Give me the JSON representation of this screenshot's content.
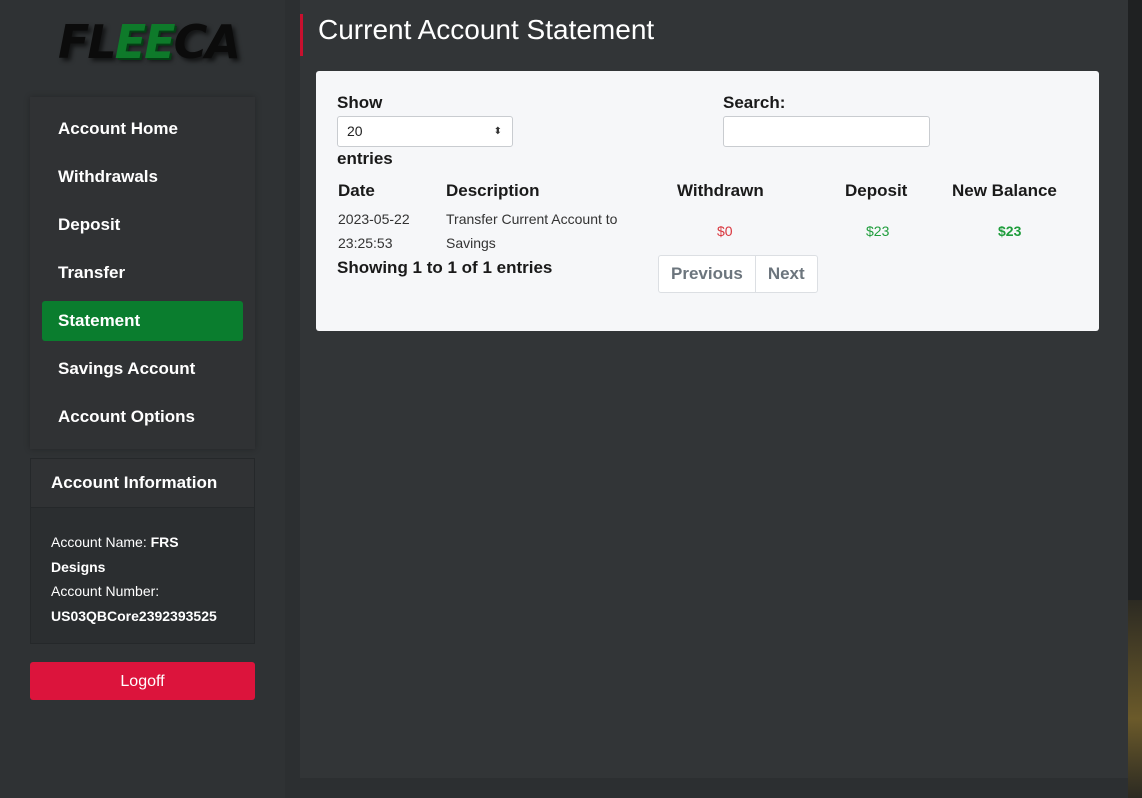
{
  "brand": {
    "logo_left": "FL",
    "logo_mid": "EE",
    "logo_right": "CA"
  },
  "sidebar": {
    "items": [
      {
        "label": "Account Home",
        "active": false
      },
      {
        "label": "Withdrawals",
        "active": false
      },
      {
        "label": "Deposit",
        "active": false
      },
      {
        "label": "Transfer",
        "active": false
      },
      {
        "label": "Statement",
        "active": true
      },
      {
        "label": "Savings Account",
        "active": false
      },
      {
        "label": "Account Options",
        "active": false
      }
    ]
  },
  "account_info": {
    "title": "Account Information",
    "name_label": "Account Name:",
    "name_value_1": "FRS",
    "name_value_2": "Designs",
    "number_label": "Account Number:",
    "number_value": "US03QBCore2392393525"
  },
  "logoff_label": "Logoff",
  "main": {
    "title": "Current Account Statement",
    "show_label": "Show",
    "entries_label": "entries",
    "page_size": "20",
    "search_label": "Search:",
    "search_value": "",
    "columns": [
      "Date",
      "Description",
      "Withdrawn",
      "Deposit",
      "New Balance"
    ],
    "rows": [
      {
        "date_1": "2023-05-22",
        "date_2": "23:25:53",
        "desc_1": "Transfer Current Account to",
        "desc_2": "Savings",
        "withdrawn": "$0",
        "deposit": "$23",
        "balance": "$23"
      }
    ],
    "info": "Showing 1 to 1 of 1 entries",
    "prev_label": "Previous",
    "next_label": "Next"
  },
  "colors": {
    "accent_green": "#0a7d2e",
    "logoff_red": "#dc143c",
    "withdrawn_red": "#d9363e",
    "deposit_green": "#1f9d3c"
  }
}
